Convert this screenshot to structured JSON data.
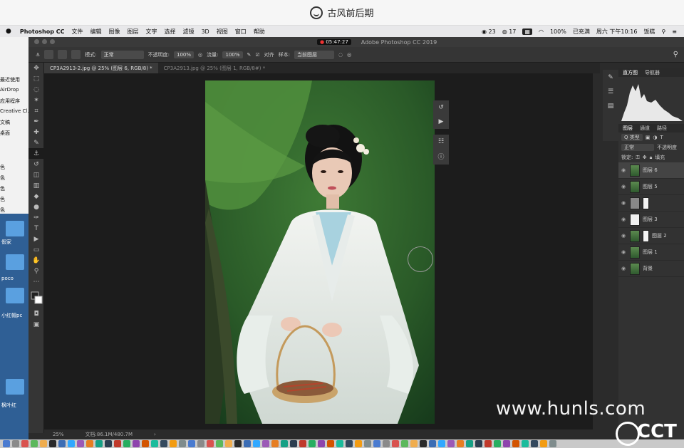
{
  "titlebar": {
    "title": "古风前后期"
  },
  "menubar": {
    "apple": "",
    "app": "Photoshop CC",
    "items": [
      "文件",
      "编辑",
      "图像",
      "图层",
      "文字",
      "选择",
      "滤镜",
      "3D",
      "视图",
      "窗口",
      "帮助"
    ],
    "status": {
      "n1": "23",
      "n2": "17",
      "battery": "100%",
      "lang": "已充满",
      "clock": "周六 下午10:16",
      "user": "饭糕"
    }
  },
  "desktop": {
    "finder_items": [
      "最近使用",
      "AirDrop",
      "应用程序",
      "Creative Cl...",
      "文稿",
      "桌面",
      "色",
      "色",
      "色",
      "色",
      "色"
    ],
    "icons": [
      "假家",
      "poco",
      "小红帽pc",
      "枫叶红"
    ]
  },
  "ps": {
    "window_title": "Adobe Photoshop CC 2019",
    "recording": "05:47:27",
    "options": {
      "mode_label": "模式:",
      "mode_value": "正常",
      "opacity_label": "不透明度:",
      "opacity_value": "100%",
      "flow_label": "流量:",
      "flow_value": "100%",
      "align_label": "对齐",
      "sample_label": "样本:",
      "sample_value": "当前图层"
    },
    "tabs": [
      "CP3A2913-2.jpg @ 25% (图层 6, RGB/8) *",
      "CP3A2913.jpg @ 25% (图层 1, RGB/8#) *"
    ],
    "status": {
      "zoom": "25%",
      "doc": "文档:86.1M/480.7M"
    },
    "panels": {
      "histogram_tabs": [
        "直方图",
        "导航器"
      ],
      "layer_tabs": [
        "图层",
        "通道",
        "路径"
      ],
      "kind": "Q 类型",
      "blend": "正常",
      "opacity": "不透明度",
      "lock": "锁定:",
      "fill": "填充",
      "layers": [
        {
          "name": "图层 6",
          "selected": true,
          "thumb": "photo",
          "mask": false
        },
        {
          "name": "图层 5",
          "selected": false,
          "thumb": "photo",
          "mask": false
        },
        {
          "name": "",
          "selected": false,
          "thumb": "gray",
          "mask": true
        },
        {
          "name": "图层 3",
          "selected": false,
          "thumb": "white",
          "mask": false
        },
        {
          "name": "图层 2",
          "selected": false,
          "thumb": "photo",
          "mask": true
        },
        {
          "name": "图层 1",
          "selected": false,
          "thumb": "photo",
          "mask": false
        },
        {
          "name": "背景",
          "selected": false,
          "thumb": "photo",
          "mask": false
        }
      ]
    }
  },
  "watermark": {
    "text": "www.hunls.com",
    "cctv": "CCT"
  }
}
